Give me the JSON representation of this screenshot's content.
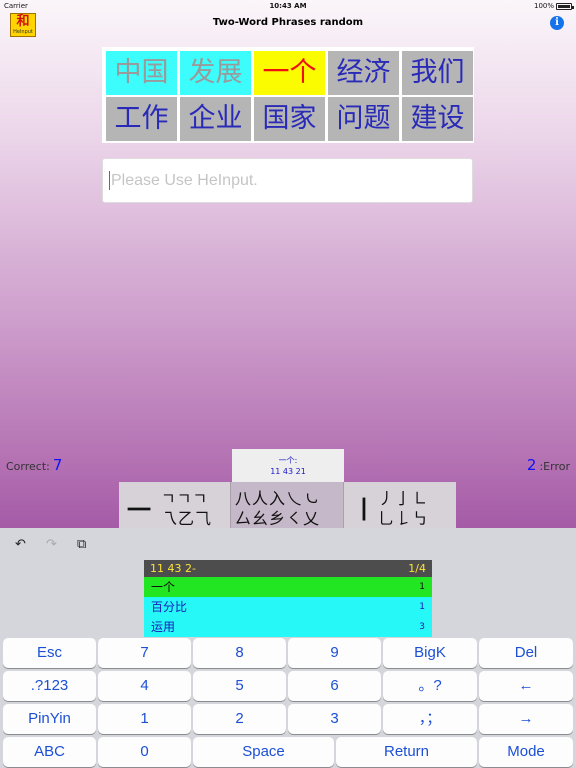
{
  "status_bar": {
    "carrier": "Carrier",
    "time": "10:43 AM",
    "battery": "100%"
  },
  "nav": {
    "title": "Two-Word Phrases random",
    "logo_glyph": "和",
    "logo_text": "HeInput",
    "info_icon": "info-icon"
  },
  "phrases": [
    {
      "text": "中国",
      "state": "done"
    },
    {
      "text": "发展",
      "state": "done"
    },
    {
      "text": "一个",
      "state": "current"
    },
    {
      "text": "经济",
      "state": "pending"
    },
    {
      "text": "我们",
      "state": "pending"
    },
    {
      "text": "工作",
      "state": "pending"
    },
    {
      "text": "企业",
      "state": "pending"
    },
    {
      "text": "国家",
      "state": "pending"
    },
    {
      "text": "问题",
      "state": "pending"
    },
    {
      "text": "建设",
      "state": "pending"
    }
  ],
  "input": {
    "placeholder": "Please Use HeInput."
  },
  "score": {
    "correct_label": "Correct:",
    "correct_value": "7",
    "error_label": ":Error",
    "error_value": "2"
  },
  "hint": {
    "line1": "一个:",
    "line2": "11 43 21"
  },
  "stroke_groups": [
    {
      "big": "一",
      "top": "ㄱㄱㄱ",
      "bottom": "乁乙⺄"
    },
    {
      "big": "",
      "top": "八人入乀㇃",
      "bottom": "厶幺乡㇛乂"
    },
    {
      "big": "丨",
      "top": "丿亅㇗",
      "bottom": "乚𠄌㇉"
    }
  ],
  "toolbar": {
    "undo_icon": "↶",
    "redo_icon": "↷",
    "copy_icon": "⧉"
  },
  "candidates": {
    "code": "11 43 2-",
    "page": "1/4",
    "items": [
      {
        "text": "一个",
        "code": "1"
      },
      {
        "text": "百分比",
        "code": "1"
      },
      {
        "text": "运用",
        "code": "3"
      }
    ]
  },
  "keyboard": {
    "rows": [
      [
        "Esc",
        "7",
        "8",
        "9",
        "BigK",
        "Del"
      ],
      [
        ".?123",
        "4",
        "5",
        "6",
        "。?",
        "←"
      ],
      [
        "PinYin",
        "1",
        "2",
        "3",
        "，；",
        "→"
      ],
      [
        "ABC",
        "0",
        "Space",
        "Return",
        "Mode"
      ]
    ]
  },
  "colors": {
    "done_bg": "#3dfcfc",
    "current_bg": "#fcfc00",
    "pending_bg": "#b5b5b5",
    "key_text": "#1b4fd6"
  }
}
